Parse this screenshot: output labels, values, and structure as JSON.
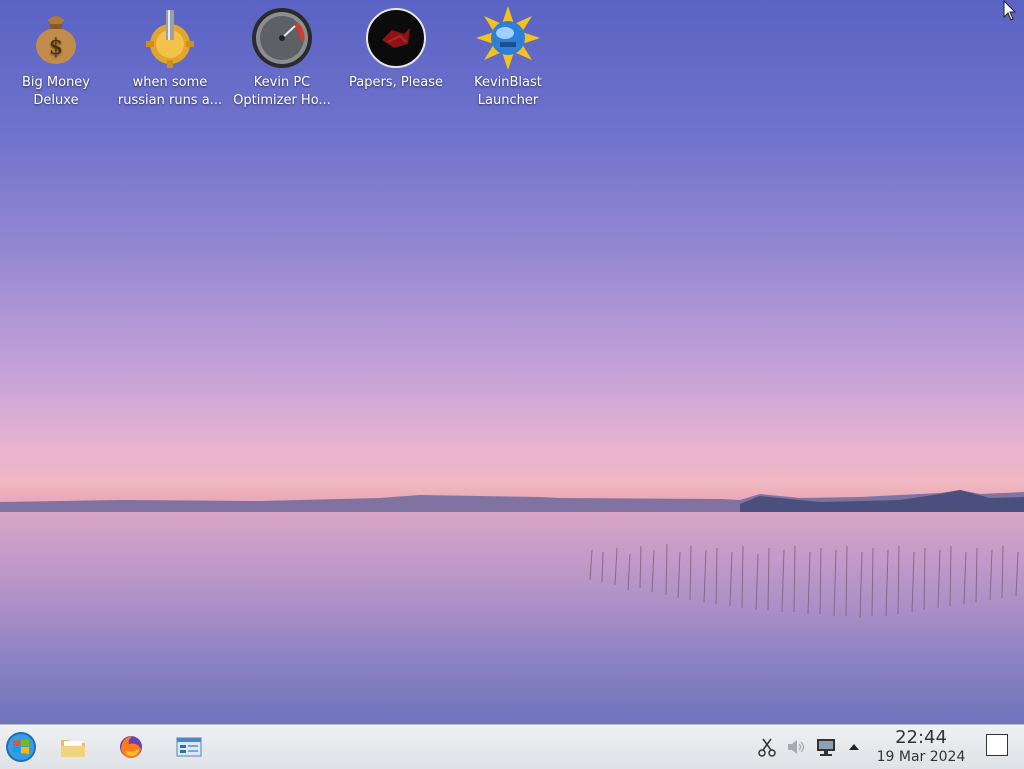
{
  "desktop": {
    "icons": [
      {
        "label": "Big Money\nDeluxe",
        "icon": "money-bag-icon"
      },
      {
        "label": "when some\nrussian runs a...",
        "icon": "gear-icon"
      },
      {
        "label": "Kevin PC\nOptimizer Ho...",
        "icon": "speedometer-icon"
      },
      {
        "label": "Papers, Please",
        "icon": "papers-please-icon"
      },
      {
        "label": "KevinBlast\nLauncher",
        "icon": "globe-star-icon"
      }
    ]
  },
  "taskbar": {
    "start_icon": "windows-start-icon",
    "pinned": [
      {
        "name": "file-manager",
        "icon": "folder-icon"
      },
      {
        "name": "firefox",
        "icon": "firefox-icon"
      },
      {
        "name": "control-panel",
        "icon": "control-panel-icon"
      }
    ],
    "tray": {
      "icons": [
        "scissors-icon",
        "volume-muted-icon",
        "network-icon",
        "expand-up-icon"
      ]
    },
    "clock": {
      "time": "22:44",
      "date": "19 Mar 2024"
    }
  }
}
